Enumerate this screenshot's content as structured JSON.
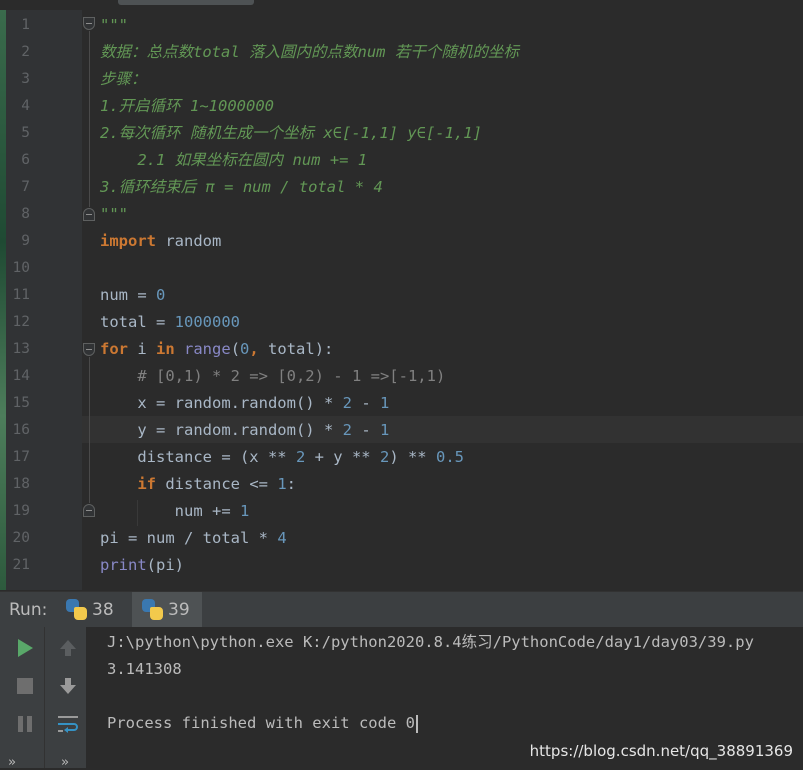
{
  "editor": {
    "lines": [
      {
        "n": "1",
        "segs": [
          {
            "c": "doc",
            "t": "\"\"\""
          }
        ]
      },
      {
        "n": "2",
        "segs": [
          {
            "c": "doc",
            "t": "数据：总点数total 落入圆内的点数num 若干个随机的坐标"
          }
        ]
      },
      {
        "n": "3",
        "segs": [
          {
            "c": "doc",
            "t": "步骤："
          }
        ]
      },
      {
        "n": "4",
        "segs": [
          {
            "c": "doc",
            "t": "1.开启循环 1~1000000"
          }
        ]
      },
      {
        "n": "5",
        "segs": [
          {
            "c": "doc",
            "t": "2.每次循环 随机生成一个坐标 x∈[-1,1] y∈[-1,1]"
          }
        ]
      },
      {
        "n": "6",
        "segs": [
          {
            "c": "doc",
            "t": "    2.1 如果坐标在圆内 num += 1"
          }
        ]
      },
      {
        "n": "7",
        "segs": [
          {
            "c": "doc",
            "t": "3.循环结束后 π = num / total * 4"
          }
        ]
      },
      {
        "n": "8",
        "segs": [
          {
            "c": "doc",
            "t": "\"\"\""
          }
        ]
      },
      {
        "n": "9",
        "segs": [
          {
            "c": "kw",
            "t": "import"
          },
          {
            "c": "",
            "t": " random"
          }
        ]
      },
      {
        "n": "10",
        "segs": []
      },
      {
        "n": "11",
        "segs": [
          {
            "c": "",
            "t": "num = "
          },
          {
            "c": "num",
            "t": "0"
          }
        ]
      },
      {
        "n": "12",
        "segs": [
          {
            "c": "",
            "t": "total = "
          },
          {
            "c": "num",
            "t": "1000000"
          }
        ]
      },
      {
        "n": "13",
        "segs": [
          {
            "c": "kw",
            "t": "for"
          },
          {
            "c": "",
            "t": " i "
          },
          {
            "c": "kw",
            "t": "in"
          },
          {
            "c": "",
            "t": " "
          },
          {
            "c": "bi",
            "t": "range"
          },
          {
            "c": "",
            "t": "("
          },
          {
            "c": "num",
            "t": "0"
          },
          {
            "c": "kw",
            "t": ","
          },
          {
            "c": "",
            "t": " total):"
          }
        ]
      },
      {
        "n": "14",
        "segs": [
          {
            "c": "",
            "t": "    "
          },
          {
            "c": "cm",
            "t": "# [0,1) * 2 => [0,2) - 1 =>[-1,1)"
          }
        ]
      },
      {
        "n": "15",
        "segs": [
          {
            "c": "",
            "t": "    x = random.random() * "
          },
          {
            "c": "num",
            "t": "2"
          },
          {
            "c": "",
            "t": " - "
          },
          {
            "c": "num",
            "t": "1"
          }
        ]
      },
      {
        "n": "16",
        "segs": [
          {
            "c": "",
            "t": "    y = random.random() * "
          },
          {
            "c": "num",
            "t": "2"
          },
          {
            "c": "",
            "t": " - "
          },
          {
            "c": "num",
            "t": "1"
          }
        ]
      },
      {
        "n": "17",
        "segs": [
          {
            "c": "",
            "t": "    distance = (x ** "
          },
          {
            "c": "num",
            "t": "2"
          },
          {
            "c": "",
            "t": " + y ** "
          },
          {
            "c": "num",
            "t": "2"
          },
          {
            "c": "",
            "t": ") ** "
          },
          {
            "c": "num",
            "t": "0.5"
          }
        ]
      },
      {
        "n": "18",
        "segs": [
          {
            "c": "",
            "t": "    "
          },
          {
            "c": "kw",
            "t": "if"
          },
          {
            "c": "",
            "t": " distance <= "
          },
          {
            "c": "num",
            "t": "1"
          },
          {
            "c": "",
            "t": ":"
          }
        ]
      },
      {
        "n": "19",
        "segs": [
          {
            "c": "",
            "t": "        num += "
          },
          {
            "c": "num",
            "t": "1"
          }
        ]
      },
      {
        "n": "20",
        "segs": [
          {
            "c": "",
            "t": "pi = num / total * "
          },
          {
            "c": "num",
            "t": "4"
          }
        ]
      },
      {
        "n": "21",
        "segs": [
          {
            "c": "bi",
            "t": "print"
          },
          {
            "c": "",
            "t": "(pi)"
          }
        ]
      }
    ]
  },
  "run": {
    "label": "Run:",
    "tabs": [
      {
        "label": "38"
      },
      {
        "label": "39"
      }
    ]
  },
  "console": {
    "lines": [
      "J:\\python\\python.exe K:/python2020.8.4练习/PythonCode/day1/day03/39.py",
      "3.141308",
      "",
      "Process finished with exit code 0"
    ]
  },
  "watermark": "https://blog.csdn.net/qq_38891369",
  "colors": {
    "keyword": "#cc7832",
    "number": "#6897bb",
    "comment": "#808080",
    "docstring": "#629755",
    "builtin": "#8888c6",
    "text": "#a9b7c6",
    "run_green": "#59a869"
  }
}
